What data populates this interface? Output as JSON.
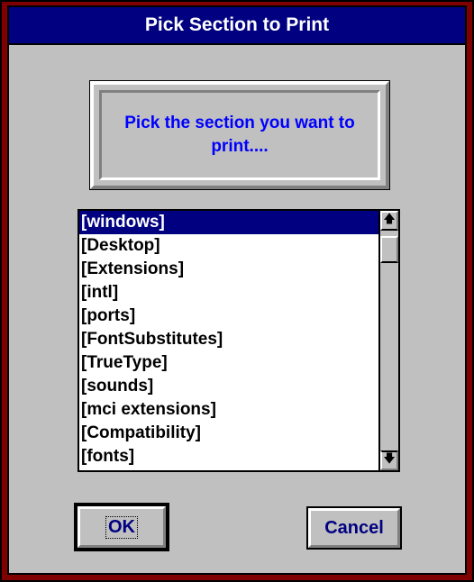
{
  "dialog": {
    "title": "Pick Section to Print"
  },
  "message": {
    "text": "Pick the section you want to print...."
  },
  "listbox": {
    "items": [
      "[windows]",
      "[Desktop]",
      "[Extensions]",
      "[intl]",
      "[ports]",
      "[FontSubstitutes]",
      "[TrueType]",
      "[sounds]",
      "[mci extensions]",
      "[Compatibility]",
      "[fonts]"
    ],
    "selected_index": 0
  },
  "scrollbar": {
    "up_icon": "arrow-up-icon",
    "down_icon": "arrow-down-icon",
    "up_glyph": "🡅",
    "down_glyph": "🡇"
  },
  "buttons": {
    "ok_label": "OK",
    "cancel_label": "Cancel"
  },
  "colors": {
    "titlebar": "#000080",
    "frame": "#800000",
    "face": "#c0c0c0",
    "message_text": "#0000ff",
    "selection": "#000080"
  }
}
